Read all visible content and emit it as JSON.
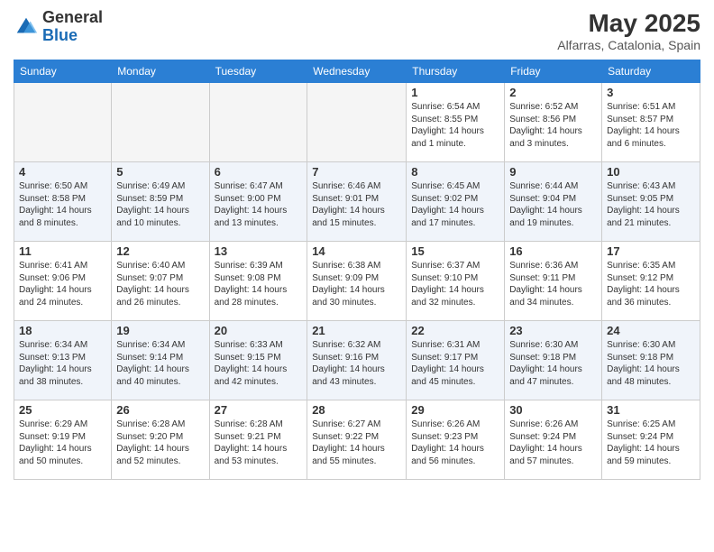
{
  "header": {
    "logo_general": "General",
    "logo_blue": "Blue",
    "month_year": "May 2025",
    "location": "Alfarras, Catalonia, Spain"
  },
  "days_of_week": [
    "Sunday",
    "Monday",
    "Tuesday",
    "Wednesday",
    "Thursday",
    "Friday",
    "Saturday"
  ],
  "weeks": [
    [
      {
        "day": "",
        "empty": true
      },
      {
        "day": "",
        "empty": true
      },
      {
        "day": "",
        "empty": true
      },
      {
        "day": "",
        "empty": true
      },
      {
        "day": "1",
        "sunrise": "6:54 AM",
        "sunset": "8:55 PM",
        "daylight": "14 hours and 1 minute."
      },
      {
        "day": "2",
        "sunrise": "6:52 AM",
        "sunset": "8:56 PM",
        "daylight": "14 hours and 3 minutes."
      },
      {
        "day": "3",
        "sunrise": "6:51 AM",
        "sunset": "8:57 PM",
        "daylight": "14 hours and 6 minutes."
      }
    ],
    [
      {
        "day": "4",
        "sunrise": "6:50 AM",
        "sunset": "8:58 PM",
        "daylight": "14 hours and 8 minutes."
      },
      {
        "day": "5",
        "sunrise": "6:49 AM",
        "sunset": "8:59 PM",
        "daylight": "14 hours and 10 minutes."
      },
      {
        "day": "6",
        "sunrise": "6:47 AM",
        "sunset": "9:00 PM",
        "daylight": "14 hours and 13 minutes."
      },
      {
        "day": "7",
        "sunrise": "6:46 AM",
        "sunset": "9:01 PM",
        "daylight": "14 hours and 15 minutes."
      },
      {
        "day": "8",
        "sunrise": "6:45 AM",
        "sunset": "9:02 PM",
        "daylight": "14 hours and 17 minutes."
      },
      {
        "day": "9",
        "sunrise": "6:44 AM",
        "sunset": "9:04 PM",
        "daylight": "14 hours and 19 minutes."
      },
      {
        "day": "10",
        "sunrise": "6:43 AM",
        "sunset": "9:05 PM",
        "daylight": "14 hours and 21 minutes."
      }
    ],
    [
      {
        "day": "11",
        "sunrise": "6:41 AM",
        "sunset": "9:06 PM",
        "daylight": "14 hours and 24 minutes."
      },
      {
        "day": "12",
        "sunrise": "6:40 AM",
        "sunset": "9:07 PM",
        "daylight": "14 hours and 26 minutes."
      },
      {
        "day": "13",
        "sunrise": "6:39 AM",
        "sunset": "9:08 PM",
        "daylight": "14 hours and 28 minutes."
      },
      {
        "day": "14",
        "sunrise": "6:38 AM",
        "sunset": "9:09 PM",
        "daylight": "14 hours and 30 minutes."
      },
      {
        "day": "15",
        "sunrise": "6:37 AM",
        "sunset": "9:10 PM",
        "daylight": "14 hours and 32 minutes."
      },
      {
        "day": "16",
        "sunrise": "6:36 AM",
        "sunset": "9:11 PM",
        "daylight": "14 hours and 34 minutes."
      },
      {
        "day": "17",
        "sunrise": "6:35 AM",
        "sunset": "9:12 PM",
        "daylight": "14 hours and 36 minutes."
      }
    ],
    [
      {
        "day": "18",
        "sunrise": "6:34 AM",
        "sunset": "9:13 PM",
        "daylight": "14 hours and 38 minutes."
      },
      {
        "day": "19",
        "sunrise": "6:34 AM",
        "sunset": "9:14 PM",
        "daylight": "14 hours and 40 minutes."
      },
      {
        "day": "20",
        "sunrise": "6:33 AM",
        "sunset": "9:15 PM",
        "daylight": "14 hours and 42 minutes."
      },
      {
        "day": "21",
        "sunrise": "6:32 AM",
        "sunset": "9:16 PM",
        "daylight": "14 hours and 43 minutes."
      },
      {
        "day": "22",
        "sunrise": "6:31 AM",
        "sunset": "9:17 PM",
        "daylight": "14 hours and 45 minutes."
      },
      {
        "day": "23",
        "sunrise": "6:30 AM",
        "sunset": "9:18 PM",
        "daylight": "14 hours and 47 minutes."
      },
      {
        "day": "24",
        "sunrise": "6:30 AM",
        "sunset": "9:18 PM",
        "daylight": "14 hours and 48 minutes."
      }
    ],
    [
      {
        "day": "25",
        "sunrise": "6:29 AM",
        "sunset": "9:19 PM",
        "daylight": "14 hours and 50 minutes."
      },
      {
        "day": "26",
        "sunrise": "6:28 AM",
        "sunset": "9:20 PM",
        "daylight": "14 hours and 52 minutes."
      },
      {
        "day": "27",
        "sunrise": "6:28 AM",
        "sunset": "9:21 PM",
        "daylight": "14 hours and 53 minutes."
      },
      {
        "day": "28",
        "sunrise": "6:27 AM",
        "sunset": "9:22 PM",
        "daylight": "14 hours and 55 minutes."
      },
      {
        "day": "29",
        "sunrise": "6:26 AM",
        "sunset": "9:23 PM",
        "daylight": "14 hours and 56 minutes."
      },
      {
        "day": "30",
        "sunrise": "6:26 AM",
        "sunset": "9:24 PM",
        "daylight": "14 hours and 57 minutes."
      },
      {
        "day": "31",
        "sunrise": "6:25 AM",
        "sunset": "9:24 PM",
        "daylight": "14 hours and 59 minutes."
      }
    ]
  ],
  "labels": {
    "sunrise": "Sunrise:",
    "sunset": "Sunset:",
    "daylight": "Daylight:"
  }
}
